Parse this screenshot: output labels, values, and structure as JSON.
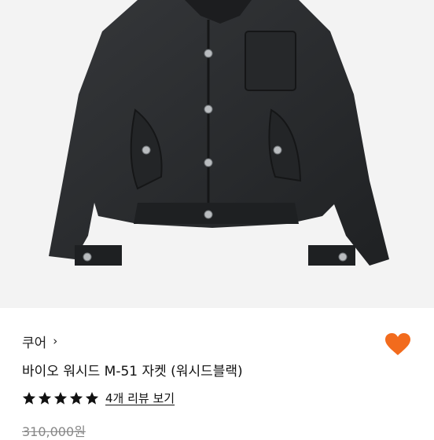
{
  "product": {
    "brand": "쿠어",
    "chevron": "›",
    "title": "바이오 워시드 M-51 자켓 (워시드블랙)",
    "rating_stars": 5,
    "reviews_label": "4개 리뷰 보기",
    "price": "310,000원",
    "image_icon": "jacket-product-image",
    "wishlist_icon": "heart-icon"
  },
  "colors": {
    "accent": "#f26b1d",
    "star": "#111111",
    "image_bg": "#f3f3f3",
    "jacket": "#2a2c2e"
  }
}
